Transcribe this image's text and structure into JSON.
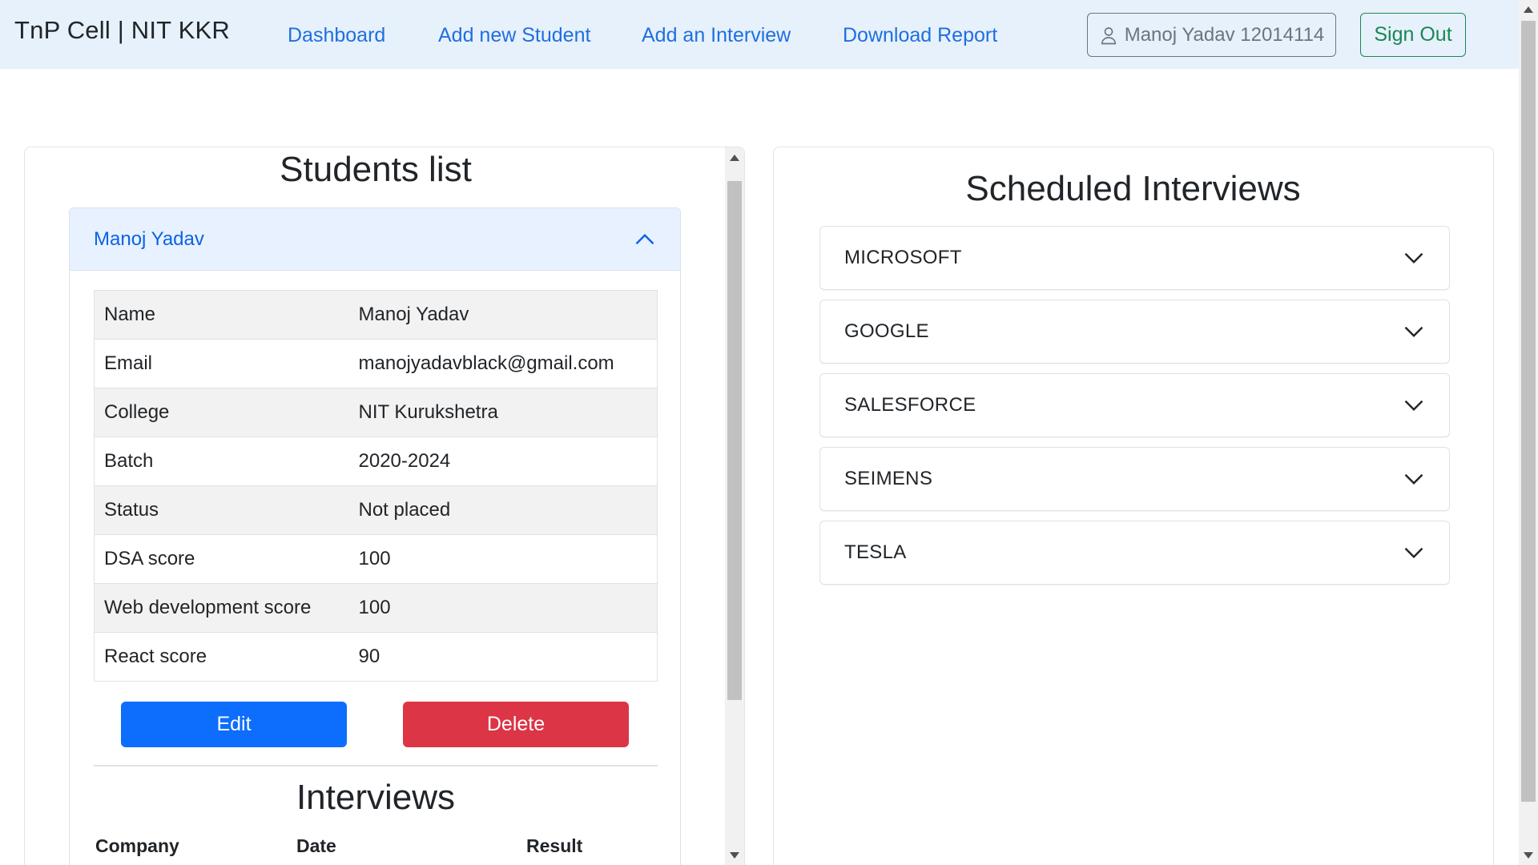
{
  "navbar": {
    "brand": "TnP Cell | NIT KKR",
    "links": [
      "Dashboard",
      "Add new Student",
      "Add an Interview",
      "Download Report"
    ],
    "user_label": "Manoj Yadav 12014114",
    "signout_label": "Sign Out"
  },
  "students": {
    "title": "Students list",
    "selected": {
      "header_name": "Manoj Yadav",
      "fields": [
        {
          "label": "Name",
          "value": "Manoj Yadav"
        },
        {
          "label": "Email",
          "value": "manojyadavblack@gmail.com"
        },
        {
          "label": "College",
          "value": "NIT Kurukshetra"
        },
        {
          "label": "Batch",
          "value": "2020-2024"
        },
        {
          "label": "Status",
          "value": "Not placed"
        },
        {
          "label": "DSA score",
          "value": "100"
        },
        {
          "label": "Web development score",
          "value": "100"
        },
        {
          "label": "React score",
          "value": "90"
        }
      ],
      "edit_label": "Edit",
      "delete_label": "Delete",
      "interviews_title": "Interviews",
      "interviews_columns": [
        "Company",
        "Date",
        "Result"
      ]
    }
  },
  "scheduled": {
    "title": "Scheduled Interviews",
    "companies": [
      "MICROSOFT",
      "GOOGLE",
      "SALESFORCE",
      "SEIMENS",
      "TESLA"
    ]
  },
  "colors": {
    "navbar_bg": "#e7f1fb",
    "link": "#1f6fe0",
    "edit": "#0d6efd",
    "delete": "#dc3545",
    "signout": "#198754"
  },
  "icons": {
    "user": "person-icon",
    "expanded": "chevron-up-icon",
    "collapsed": "chevron-down-icon"
  }
}
